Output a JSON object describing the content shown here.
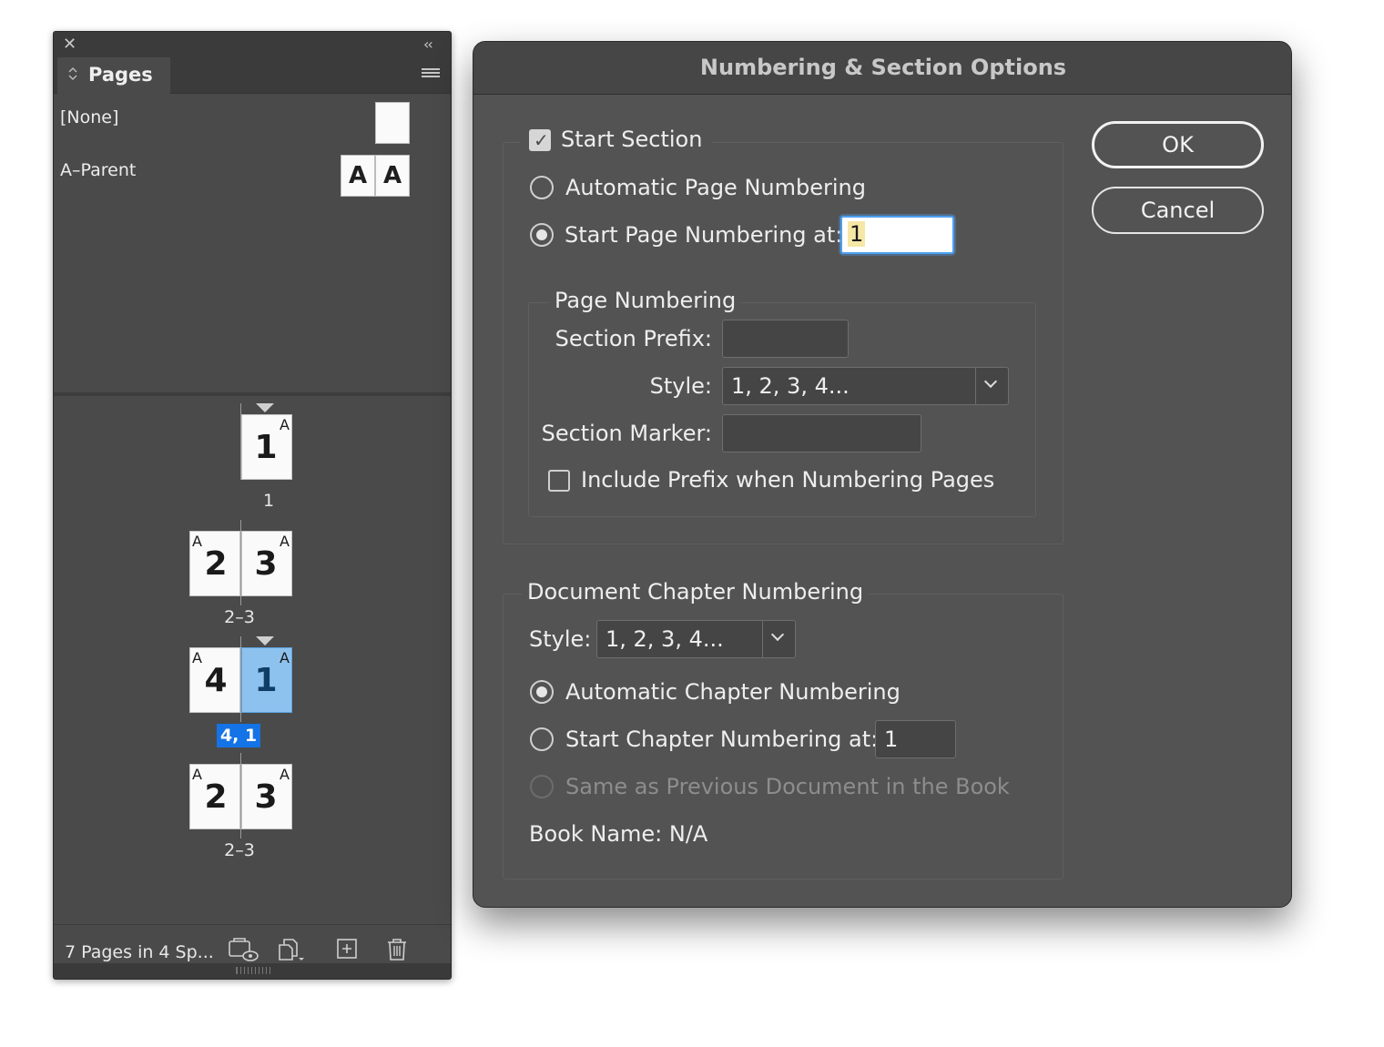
{
  "pages_panel": {
    "close_glyph": "✕",
    "collapse_glyph": "‹‹",
    "tab_label": "Pages",
    "parents": [
      {
        "name": "[None]"
      },
      {
        "name": "A–Parent",
        "letters": [
          "A",
          "A"
        ]
      }
    ],
    "spreads": [
      {
        "pages": [
          "1"
        ],
        "prefix": [
          "A"
        ],
        "caption": "1"
      },
      {
        "pages": [
          "2",
          "3"
        ],
        "prefix": [
          "A",
          "A"
        ],
        "caption": "2–3"
      },
      {
        "pages": [
          "4",
          "1"
        ],
        "prefix": [
          "A",
          "A"
        ],
        "caption": "4, 1",
        "selected_page": 1
      },
      {
        "pages": [
          "2",
          "3"
        ],
        "prefix": [
          "A",
          "A"
        ],
        "caption": "2–3"
      }
    ],
    "status": "7 Pages in 4 Sp...",
    "footer_icons": [
      "edit-page-size-icon",
      "new-parent-icon",
      "new-page-icon",
      "delete-page-icon"
    ]
  },
  "dialog": {
    "title": "Numbering & Section Options",
    "start_section": {
      "label": "Start Section",
      "checked": true
    },
    "auto_page_numbering": {
      "label": "Automatic Page Numbering",
      "selected": false
    },
    "start_page_numbering": {
      "label": "Start Page Numbering at:",
      "value": "1",
      "selected": true
    },
    "page_numbering": {
      "legend": "Page Numbering",
      "section_prefix_label": "Section Prefix:",
      "section_prefix_value": "",
      "style_label": "Style:",
      "style_value": "1, 2, 3, 4...",
      "section_marker_label": "Section Marker:",
      "section_marker_value": "",
      "include_prefix": {
        "label": "Include Prefix when Numbering Pages",
        "checked": false
      }
    },
    "chapter_numbering": {
      "legend": "Document Chapter Numbering",
      "style_label": "Style:",
      "style_value": "1, 2, 3, 4...",
      "automatic": {
        "label": "Automatic Chapter Numbering",
        "selected": true
      },
      "start_at": {
        "label": "Start Chapter Numbering at:",
        "value": "1",
        "selected": false
      },
      "same_as_previous": {
        "label": "Same as Previous Document in the Book",
        "enabled": false
      },
      "book_name": "Book Name: N/A"
    },
    "buttons": {
      "ok": "OK",
      "cancel": "Cancel"
    }
  },
  "colors": {
    "selection": "#1473e6",
    "selected_page": "#8ec2ee",
    "focus_ring": "#4e9ff0"
  }
}
